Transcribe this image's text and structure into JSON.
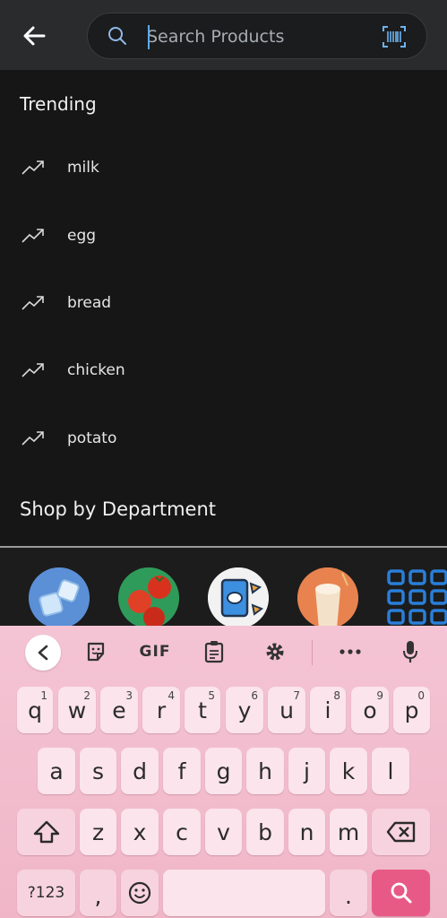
{
  "header": {
    "search_placeholder": "Search Products"
  },
  "trending": {
    "title": "Trending",
    "items": [
      "milk",
      "egg",
      "bread",
      "chicken",
      "potato"
    ]
  },
  "departments": {
    "title": "Shop by Department"
  },
  "keyboard": {
    "toolbar": {
      "gif_label": "GIF"
    },
    "row1": [
      {
        "key": "q",
        "hint": "1"
      },
      {
        "key": "w",
        "hint": "2"
      },
      {
        "key": "e",
        "hint": "3"
      },
      {
        "key": "r",
        "hint": "4"
      },
      {
        "key": "t",
        "hint": "5"
      },
      {
        "key": "y",
        "hint": "6"
      },
      {
        "key": "u",
        "hint": "7"
      },
      {
        "key": "i",
        "hint": "8"
      },
      {
        "key": "o",
        "hint": "9"
      },
      {
        "key": "p",
        "hint": "0"
      }
    ],
    "row2": [
      "a",
      "s",
      "d",
      "f",
      "g",
      "h",
      "j",
      "k",
      "l"
    ],
    "row3": [
      "z",
      "x",
      "c",
      "v",
      "b",
      "n",
      "m"
    ],
    "row4": {
      "symbols": "?123",
      "comma": ",",
      "period": "."
    }
  }
}
